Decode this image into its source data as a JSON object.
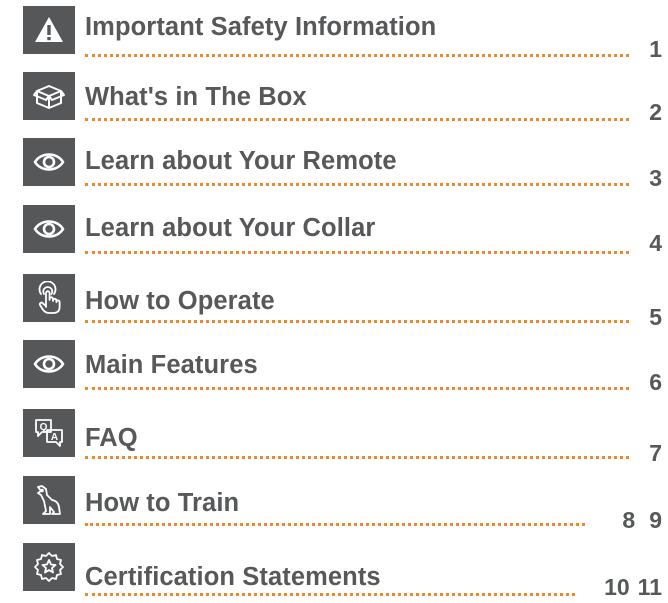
{
  "toc": [
    {
      "icon": "warning-icon",
      "title": "Important Safety Information",
      "pages": [
        "1"
      ]
    },
    {
      "icon": "box-icon",
      "title": "What's in The Box",
      "pages": [
        "2"
      ]
    },
    {
      "icon": "eye-icon",
      "title": "Learn about Your Remote",
      "pages": [
        "3"
      ]
    },
    {
      "icon": "eye-icon",
      "title": "Learn about Your Collar",
      "pages": [
        "4"
      ]
    },
    {
      "icon": "touch-hand-icon",
      "title": "How to Operate",
      "pages": [
        "5"
      ]
    },
    {
      "icon": "eye-icon",
      "title": "Main Features",
      "pages": [
        "6"
      ]
    },
    {
      "icon": "qa-chat-icon",
      "title": "FAQ",
      "pages": [
        "7"
      ]
    },
    {
      "icon": "dog-icon",
      "title": "How to Train",
      "pages": [
        "8",
        "9"
      ]
    },
    {
      "icon": "certificate-badge-icon",
      "title": "Certification Statements",
      "pages": [
        "10",
        "11"
      ]
    }
  ],
  "colors": {
    "icon_bg": "#555759",
    "text": "#56585a",
    "leader_dots": "#e98a2c"
  }
}
